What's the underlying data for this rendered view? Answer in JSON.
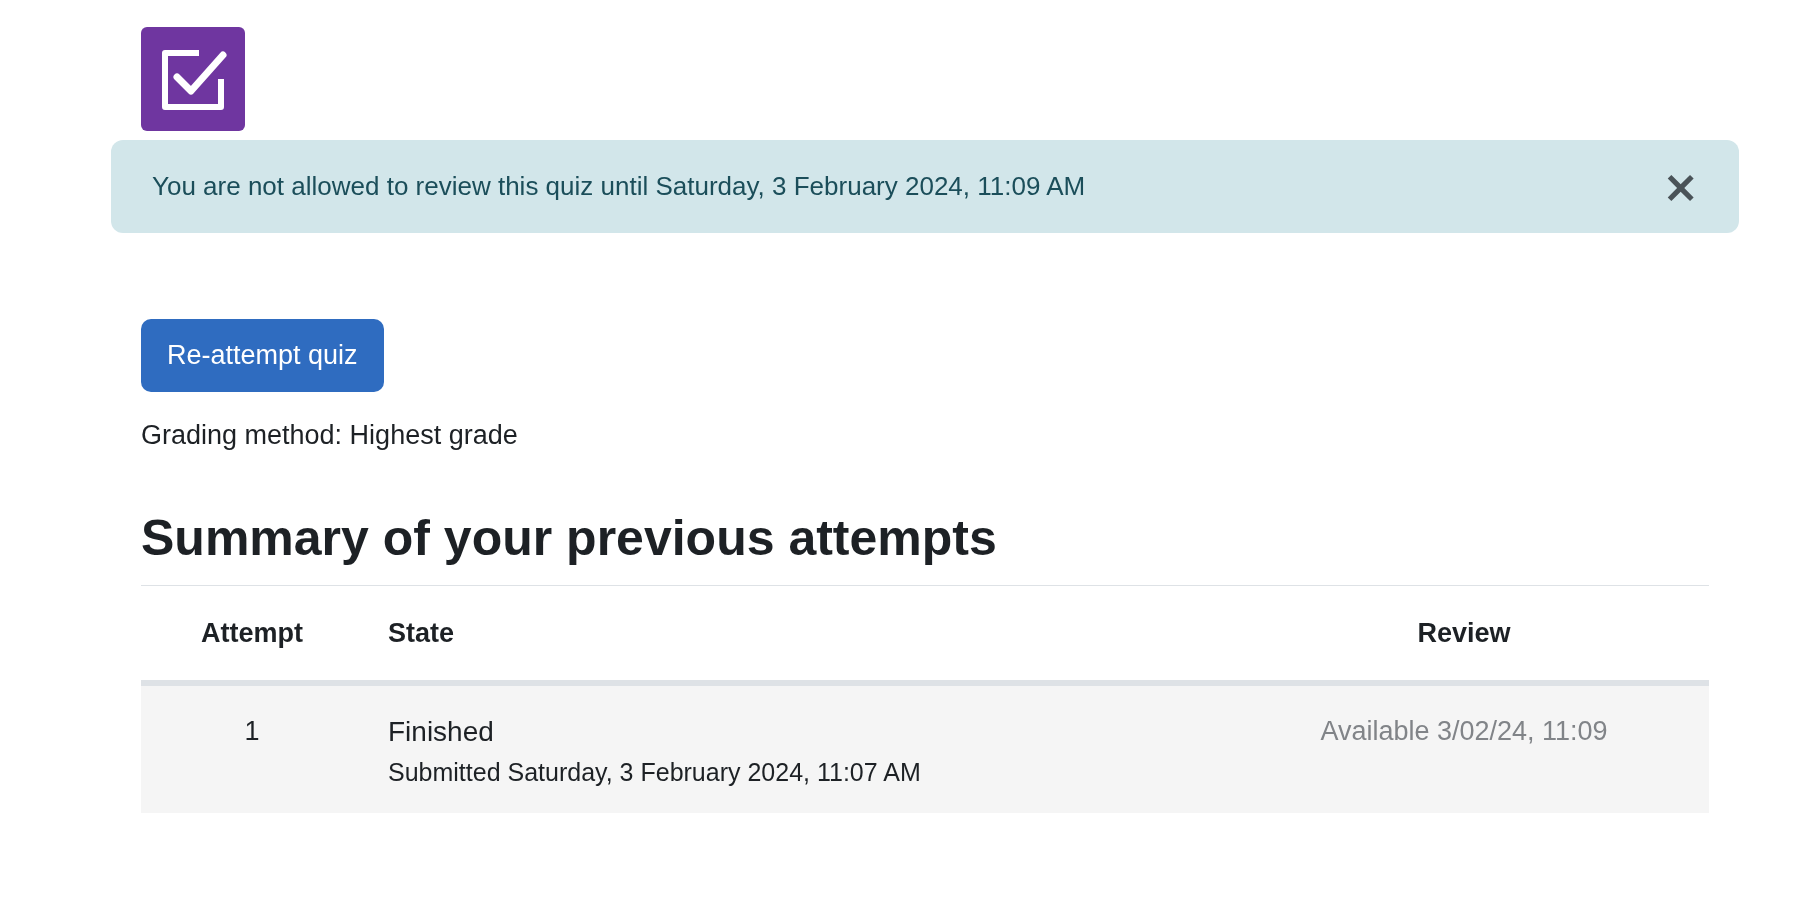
{
  "alert": {
    "message": "You are not allowed to review this quiz until Saturday, 3 February 2024, 11:09 AM",
    "close": "×"
  },
  "reattempt_button": "Re-attempt quiz",
  "grading_method": "Grading method: Highest grade",
  "summary": {
    "title": "Summary of your previous attempts",
    "columns": [
      "Attempt",
      "State",
      "Review"
    ],
    "rows": [
      {
        "attempt": "1",
        "state": "Finished",
        "submitted": "Submitted Saturday, 3 February 2024, 11:07 AM",
        "review": "Available 3/02/24, 11:09",
        "review_available": false
      }
    ]
  }
}
